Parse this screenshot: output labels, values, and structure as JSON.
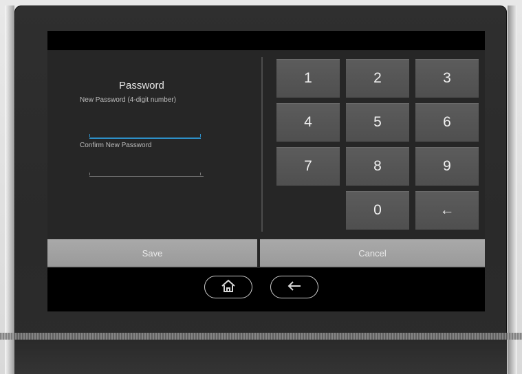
{
  "form": {
    "title": "Password",
    "new_password_label": "New Password (4-digit number)",
    "confirm_password_label": "Confirm New Password",
    "new_password_value": "",
    "confirm_password_value": ""
  },
  "keypad": {
    "keys": [
      "1",
      "2",
      "3",
      "4",
      "5",
      "6",
      "7",
      "8",
      "9",
      "0",
      "←"
    ]
  },
  "actions": {
    "save_label": "Save",
    "cancel_label": "Cancel"
  },
  "nav": {
    "home_icon": "home-icon",
    "back_icon": "back-arrow-icon"
  },
  "colors": {
    "accent": "#2d8fc7",
    "key_bg": "#555555",
    "action_bg": "#a3a3a3"
  }
}
